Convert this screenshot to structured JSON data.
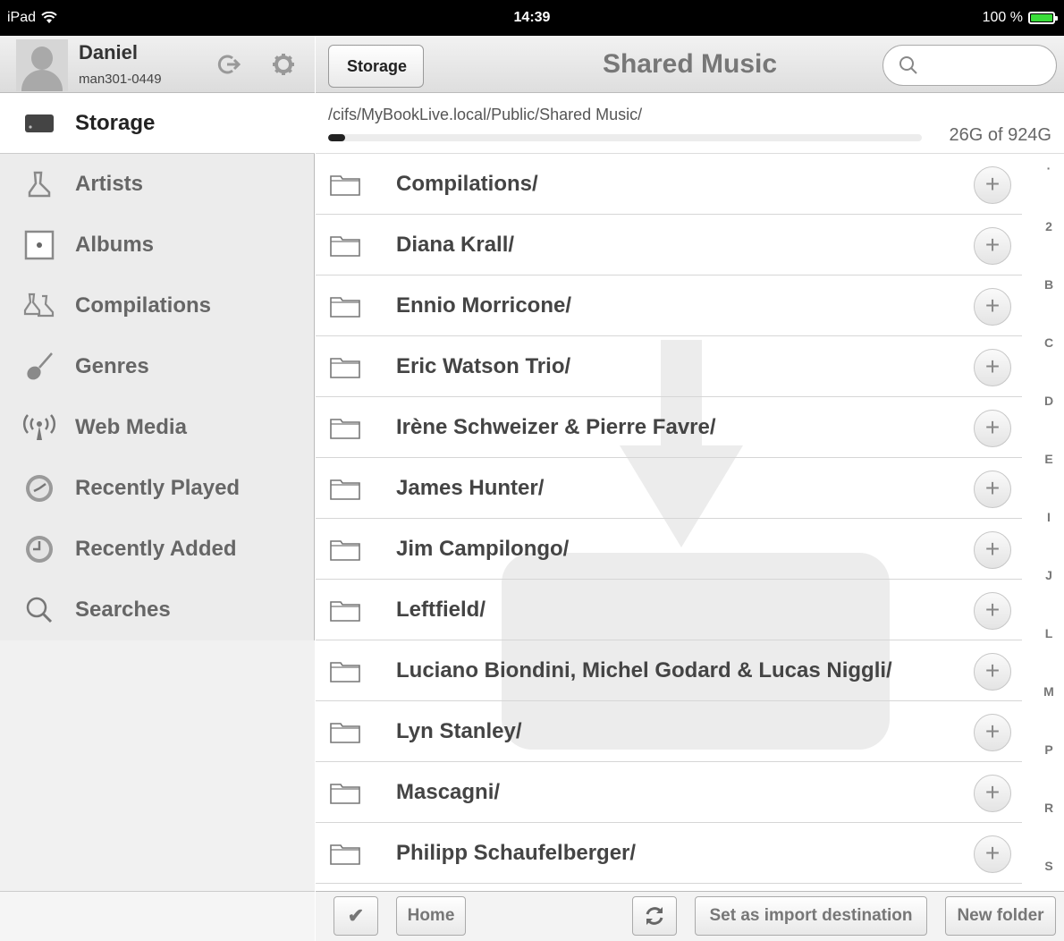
{
  "status_bar": {
    "device": "iPad",
    "wifi_icon": "wifi-icon",
    "time": "14:39",
    "battery_text": "100 %",
    "battery_level": 1.0
  },
  "profile": {
    "name": "Daniel",
    "user_id": "man301-0449"
  },
  "sidebar": {
    "items": [
      {
        "label": "Storage",
        "icon": "storage-icon",
        "active": true
      },
      {
        "label": "Artists",
        "icon": "artist-icon"
      },
      {
        "label": "Albums",
        "icon": "album-icon"
      },
      {
        "label": "Compilations",
        "icon": "compilations-icon"
      },
      {
        "label": "Genres",
        "icon": "guitar-icon"
      },
      {
        "label": "Web Media",
        "icon": "broadcast-icon"
      },
      {
        "label": "Recently Played",
        "icon": "clock-icon"
      },
      {
        "label": "Recently Added",
        "icon": "clock-icon"
      },
      {
        "label": "Searches",
        "icon": "search-icon"
      }
    ]
  },
  "navbar": {
    "back_label": "Storage",
    "title": "Shared Music",
    "search_placeholder": ""
  },
  "path_bar": {
    "path": "/cifs/MyBookLive.local/Public/Shared Music/",
    "usage": "26G of 924G",
    "used_fraction": 0.028
  },
  "folders": [
    "Compilations/",
    "Diana Krall/",
    "Ennio Morricone/",
    "Eric Watson Trio/",
    "Irène Schweizer & Pierre Favre/",
    "James Hunter/",
    "Jim Campilongo/",
    "Leftfield/",
    "Luciano Biondini, Michel Godard & Lucas Niggli/",
    "Lyn Stanley/",
    "Mascagni/",
    "Philipp Schaufelberger/"
  ],
  "add_label": "+",
  "index_letters": [
    "·",
    "2",
    "B",
    "C",
    "D",
    "E",
    "I",
    "J",
    "L",
    "M",
    "P",
    "R",
    "S"
  ],
  "toolbar": {
    "check_label": "✔",
    "home_label": "Home",
    "import_label": "Set as import destination",
    "new_folder_label": "New folder"
  }
}
